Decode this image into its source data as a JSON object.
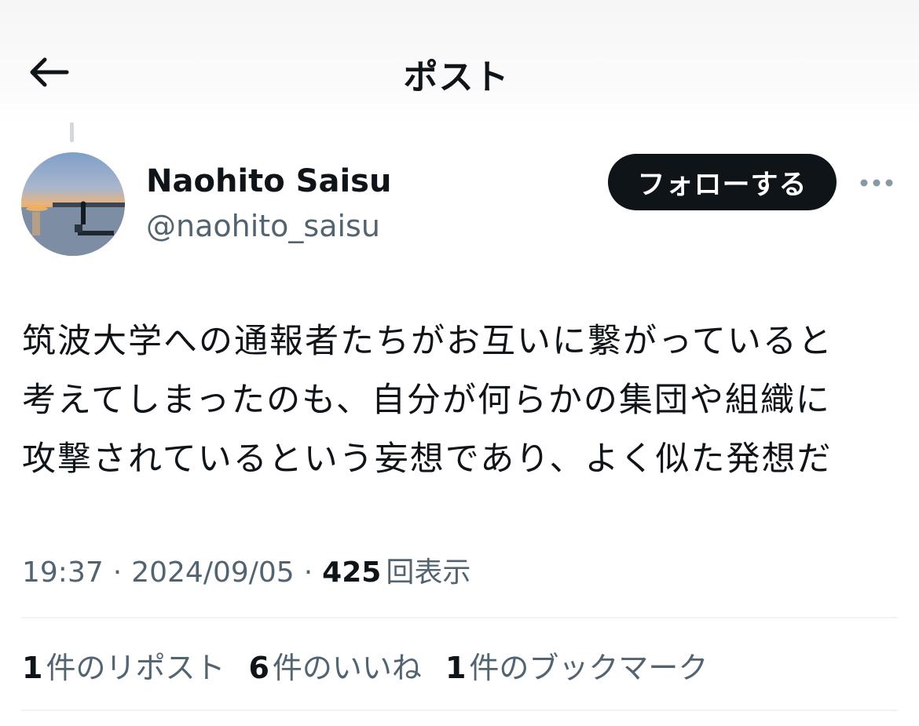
{
  "header": {
    "title": "ポスト",
    "back_icon": "arrow-left-icon"
  },
  "author": {
    "display_name": "Naohito Saisu",
    "handle": "@naohito_saisu",
    "follow_label": "フォローする",
    "more_icon": "more-horizontal-icon"
  },
  "post": {
    "lines": [
      "筑波大学への通報者たちがお互いに繋がっていると",
      "考えてしまったのも、自分が何らかの集団や組織に",
      "攻撃されているという妄想であり、よく似た発想だ"
    ],
    "time": "19:37",
    "date": "2024/09/05",
    "separator": "·",
    "views_count": "425",
    "views_label": "回表示"
  },
  "stats": {
    "reposts_count": "1",
    "reposts_label": "件のリポスト",
    "likes_count": "6",
    "likes_label": "件のいいね",
    "bookmarks_count": "1",
    "bookmarks_label": "件のブックマーク"
  },
  "colors": {
    "text_primary": "#0f1419",
    "text_secondary": "#536471",
    "divider": "#eff3f4",
    "follow_button_bg": "#0f1419"
  }
}
